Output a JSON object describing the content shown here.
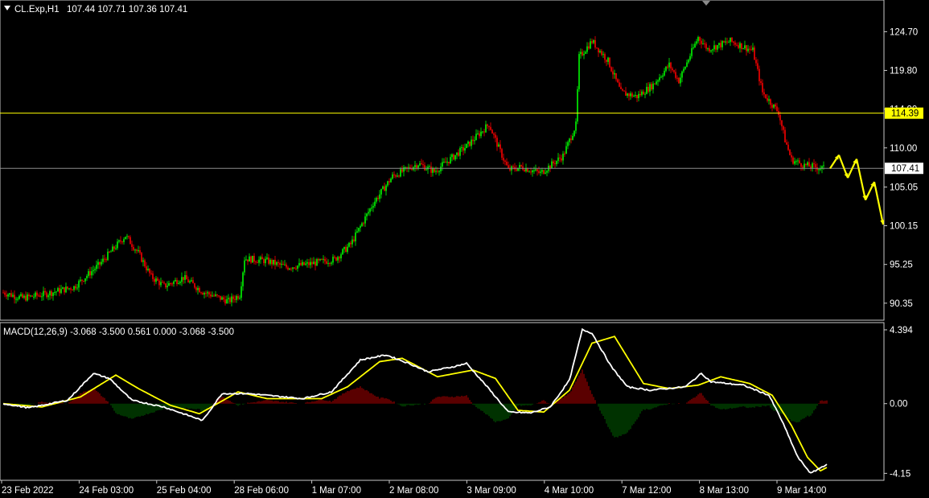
{
  "header": {
    "symbol": "CL.Exp,H1",
    "ohlc": "107.44 107.71 107.36 107.41",
    "macd_label": "MACD(12,26,9) -3.068 -3.500 0.561 0.000 -3.068 -3.500"
  },
  "colors": {
    "background": "#000000",
    "bull": "#00c800",
    "bear": "#c80000",
    "macd_line": "#ffffff",
    "signal_line": "#ffff00",
    "hist_pos": "#b40000",
    "hist_neg": "#006400",
    "support_line": "#ffff00",
    "price_line": "#8c8c8c",
    "forecast_arrow": "#ffff00"
  },
  "chart_data": [
    {
      "type": "candlestick",
      "title": "CL.Exp,H1",
      "y_ticks": [
        "124.70",
        "119.80",
        "114.90",
        "110.00",
        "105.05",
        "100.15",
        "95.25",
        "90.35"
      ],
      "ylim": [
        88.4,
        128.2
      ],
      "x_ticks": [
        "23 Feb 2022",
        "24 Feb 03:00",
        "25 Feb 04:00",
        "28 Feb 06:00",
        "1 Mar 07:00",
        "2 Mar 08:00",
        "3 Mar 09:00",
        "4 Mar 10:00",
        "7 Mar 12:00",
        "8 Mar 13:00",
        "9 Mar 14:00"
      ],
      "horizontal_level": {
        "value": 114.39,
        "label": "114.39"
      },
      "current_price": {
        "value": 107.41,
        "label": "107.41"
      },
      "anchors": [
        [
          0,
          91.7
        ],
        [
          12,
          91.0
        ],
        [
          26,
          91.5
        ],
        [
          44,
          92.4
        ],
        [
          60,
          95.3
        ],
        [
          76,
          98.9
        ],
        [
          84,
          96.7
        ],
        [
          92,
          93.7
        ],
        [
          100,
          92.5
        ],
        [
          112,
          93.6
        ],
        [
          124,
          91.8
        ],
        [
          140,
          90.6
        ],
        [
          147,
          91.4
        ],
        [
          150,
          96.0
        ],
        [
          164,
          95.7
        ],
        [
          176,
          94.9
        ],
        [
          190,
          95.3
        ],
        [
          206,
          95.9
        ],
        [
          216,
          97.8
        ],
        [
          230,
          103.0
        ],
        [
          242,
          106.4
        ],
        [
          258,
          108.0
        ],
        [
          268,
          107.0
        ],
        [
          288,
          110.2
        ],
        [
          302,
          113.0
        ],
        [
          308,
          110.0
        ],
        [
          314,
          107.2
        ],
        [
          322,
          107.6
        ],
        [
          334,
          106.8
        ],
        [
          348,
          109.0
        ],
        [
          356,
          112.9
        ],
        [
          358,
          121.5
        ],
        [
          366,
          123.5
        ],
        [
          376,
          121.0
        ],
        [
          384,
          117.0
        ],
        [
          394,
          116.5
        ],
        [
          404,
          118.0
        ],
        [
          414,
          120.5
        ],
        [
          420,
          118.5
        ],
        [
          432,
          124.0
        ],
        [
          438,
          122.5
        ],
        [
          452,
          123.5
        ],
        [
          466,
          122.3
        ],
        [
          472,
          117.0
        ],
        [
          482,
          114.5
        ],
        [
          486,
          111.0
        ],
        [
          490,
          108.5
        ],
        [
          498,
          107.8
        ],
        [
          510,
          107.4
        ]
      ],
      "forecast": [
        [
          107.4,
          109.1
        ],
        [
          109.1,
          106.2
        ],
        [
          106.2,
          108.6
        ],
        [
          108.6,
          103.4
        ],
        [
          103.4,
          105.7
        ],
        [
          105.7,
          100.3
        ]
      ]
    },
    {
      "type": "line",
      "title": "MACD(12,26,9)",
      "y_ticks": [
        "4.394",
        "0.00",
        "-4.15"
      ],
      "ylim": [
        -4.42,
        4.68
      ],
      "series": [
        {
          "name": "MACD",
          "anchors": [
            [
              0,
              0.0
            ],
            [
              16,
              -0.25
            ],
            [
              40,
              0.2
            ],
            [
              56,
              1.8
            ],
            [
              66,
              1.5
            ],
            [
              80,
              0.2
            ],
            [
              100,
              -0.2
            ],
            [
              124,
              -1.0
            ],
            [
              136,
              0.6
            ],
            [
              152,
              0.6
            ],
            [
              186,
              0.3
            ],
            [
              204,
              0.7
            ],
            [
              222,
              2.6
            ],
            [
              238,
              2.9
            ],
            [
              252,
              2.4
            ],
            [
              264,
              1.9
            ],
            [
              280,
              2.2
            ],
            [
              288,
              2.4
            ],
            [
              300,
              1.1
            ],
            [
              314,
              -0.5
            ],
            [
              328,
              -0.55
            ],
            [
              340,
              -0.2
            ],
            [
              352,
              1.4
            ],
            [
              360,
              4.4
            ],
            [
              366,
              4.2
            ],
            [
              378,
              2.2
            ],
            [
              388,
              1.0
            ],
            [
              402,
              0.8
            ],
            [
              424,
              1.0
            ],
            [
              434,
              1.8
            ],
            [
              440,
              1.3
            ],
            [
              460,
              1.1
            ],
            [
              476,
              0.5
            ],
            [
              484,
              -1.0
            ],
            [
              494,
              -3.2
            ],
            [
              502,
              -4.15
            ],
            [
              512,
              -3.6
            ]
          ]
        },
        {
          "name": "Signal",
          "anchors": [
            [
              0,
              0.0
            ],
            [
              24,
              -0.2
            ],
            [
              48,
              0.4
            ],
            [
              70,
              1.7
            ],
            [
              84,
              0.9
            ],
            [
              104,
              -0.1
            ],
            [
              122,
              -0.6
            ],
            [
              146,
              0.7
            ],
            [
              164,
              0.3
            ],
            [
              198,
              0.3
            ],
            [
              214,
              1.0
            ],
            [
              234,
              2.5
            ],
            [
              248,
              2.7
            ],
            [
              270,
              1.6
            ],
            [
              292,
              2.0
            ],
            [
              306,
              1.5
            ],
            [
              320,
              -0.4
            ],
            [
              336,
              -0.5
            ],
            [
              352,
              0.8
            ],
            [
              366,
              3.6
            ],
            [
              380,
              4.0
            ],
            [
              398,
              1.2
            ],
            [
              414,
              0.9
            ],
            [
              432,
              1.1
            ],
            [
              446,
              1.6
            ],
            [
              464,
              1.2
            ],
            [
              478,
              0.5
            ],
            [
              490,
              -1.3
            ],
            [
              500,
              -3.2
            ],
            [
              508,
              -4.0
            ],
            [
              512,
              -3.8
            ]
          ]
        }
      ]
    }
  ]
}
